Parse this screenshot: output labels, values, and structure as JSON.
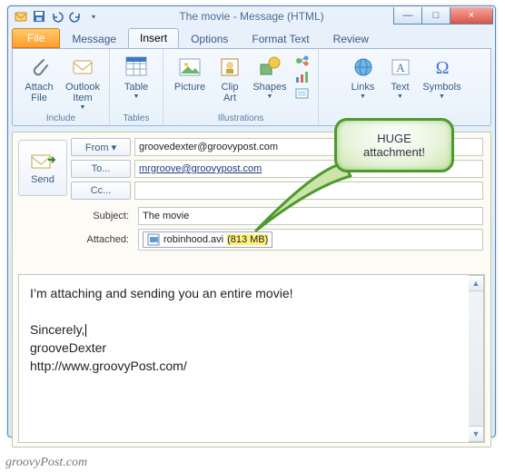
{
  "window": {
    "title": "The movie  -  Message (HTML)",
    "buttons": {
      "min": "—",
      "max": "□",
      "close": "×"
    }
  },
  "qat": {
    "save_icon": "save-icon",
    "undo_icon": "undo-icon",
    "redo_icon": "redo-icon",
    "more_icon": "more-icon"
  },
  "tabs": {
    "file": "File",
    "message": "Message",
    "insert": "Insert",
    "options": "Options",
    "format_text": "Format Text",
    "review": "Review"
  },
  "ribbon": {
    "include": {
      "label": "Include",
      "attach_file": "Attach\nFile",
      "outlook_item": "Outlook\nItem"
    },
    "tables": {
      "label": "Tables",
      "table": "Table"
    },
    "illustrations": {
      "label": "Illustrations",
      "picture": "Picture",
      "clip_art": "Clip\nArt",
      "shapes": "Shapes"
    },
    "right": {
      "links": "Links",
      "text": "Text",
      "symbols": "Symbols"
    }
  },
  "compose": {
    "send": "Send",
    "from_label": "From ▾",
    "from_value": "groovedexter@groovypost.com",
    "to_label": "To...",
    "to_value": "mrgroove@groovypost.com",
    "cc_label": "Cc...",
    "cc_value": "",
    "subject_label": "Subject:",
    "subject_value": "The movie",
    "attached_label": "Attached:",
    "attachment_name": "robinhood.avi",
    "attachment_size": "(813 MB)"
  },
  "body": {
    "line1": "I’m attaching and sending you an entire movie!",
    "line2": "Sincerely,",
    "line3": "grooveDexter",
    "line4": "http://www.groovyPost.com/"
  },
  "callout": {
    "line1": "HUGE",
    "line2": "attachment!"
  },
  "watermark": "groovyPost.com"
}
